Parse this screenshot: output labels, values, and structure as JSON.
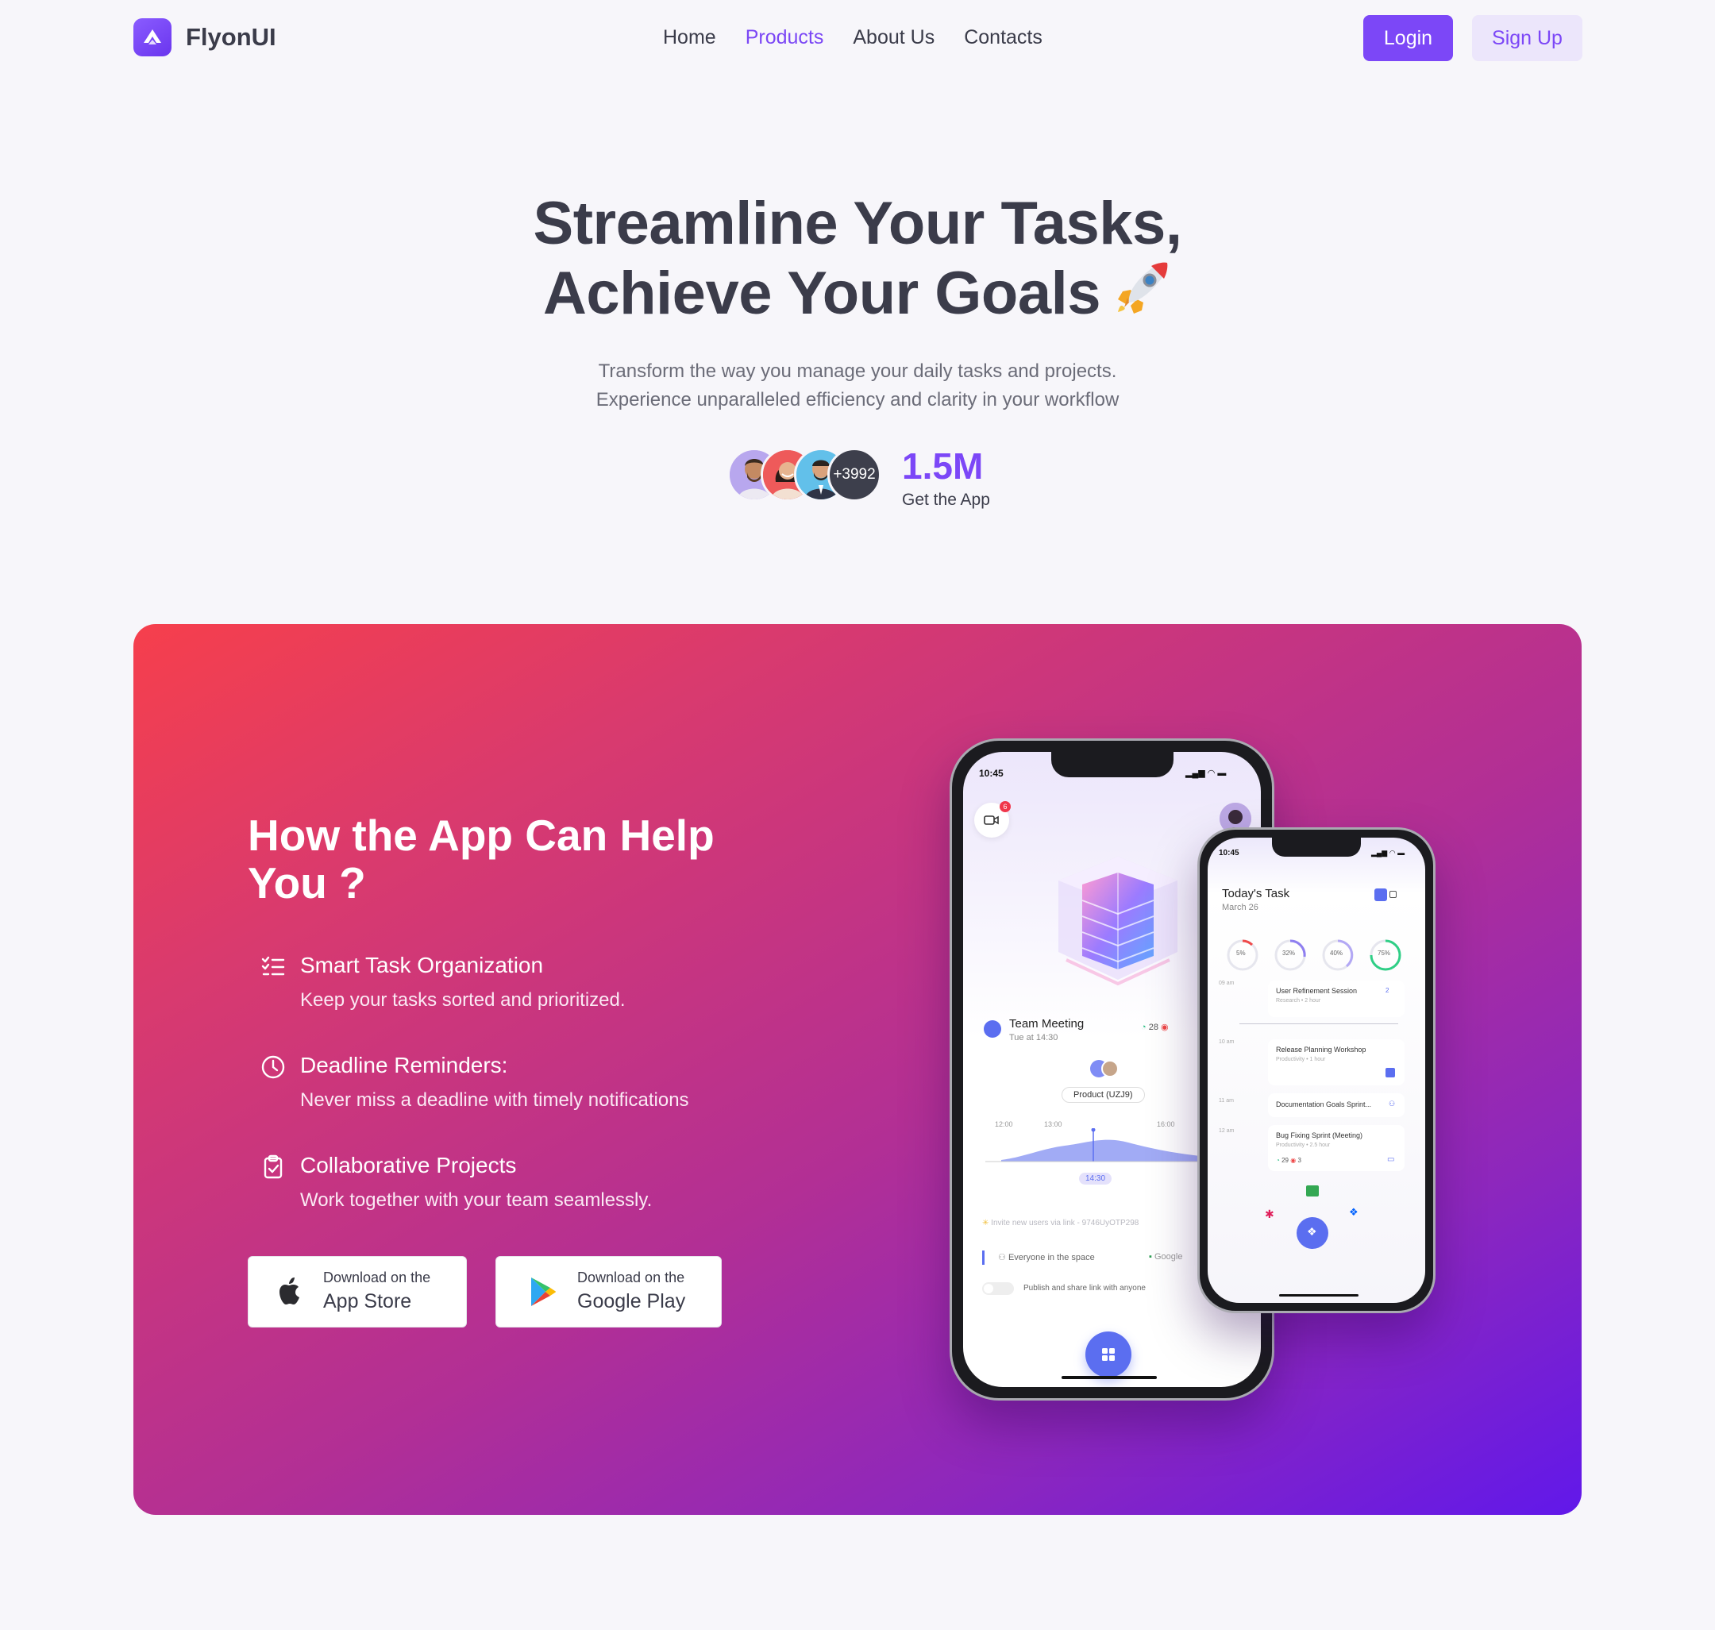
{
  "nav": {
    "brand": "FlyonUI",
    "links": [
      {
        "label": "Home",
        "active": false
      },
      {
        "label": "Products",
        "active": true
      },
      {
        "label": "About Us",
        "active": false
      },
      {
        "label": "Contacts",
        "active": false
      }
    ],
    "login_label": "Login",
    "signup_label": "Sign Up"
  },
  "hero": {
    "title_line1": "Streamline Your Tasks,",
    "title_line2": "Achieve Your Goals",
    "subtitle_line1": "Transform the way you manage your daily tasks and projects.",
    "subtitle_line2": "Experience unparalleled efficiency and clarity in your workflow",
    "avatar_more": "+3992",
    "stat_value": "1.5M",
    "stat_label": "Get the App"
  },
  "feature_card": {
    "title": "How the App Can Help You ?",
    "features": [
      {
        "icon": "checklist-icon",
        "title": "Smart Task Organization",
        "desc": "Keep your tasks sorted and prioritized."
      },
      {
        "icon": "clock-icon",
        "title": "Deadline Reminders:",
        "desc": "Never miss a deadline with timely notifications"
      },
      {
        "icon": "clipboard-check-icon",
        "title": "Collaborative Projects",
        "desc": "Work together with your team seamlessly."
      }
    ],
    "app_store": {
      "line1": "Download on the",
      "line2": "App Store"
    },
    "google_play": {
      "line1": "Download on the",
      "line2": "Google Play"
    }
  },
  "phone_large": {
    "time": "10:45",
    "badge": "6",
    "meeting_title": "Team Meeting",
    "meeting_time": "Tue at 14:30",
    "meeting_count": "28",
    "product_label": "Product (UZJ9)",
    "chart_ticks": [
      "12:00",
      "13:00",
      "16:00"
    ],
    "chart_marker": "14:30",
    "invite_text": "Invite new users via link - 9746UyOTP298",
    "space_text": "Everyone in the space",
    "google_text": "Google",
    "publish_text": "Publish and share link with anyone"
  },
  "phone_small": {
    "time": "10:45",
    "title": "Today's Task",
    "date": "March 26",
    "progress": [
      "5%",
      "32%",
      "40%",
      "75%"
    ],
    "hours": [
      "09 am",
      "10 am",
      "11 am",
      "12 am"
    ],
    "tasks": [
      {
        "title": "User Refinement Session",
        "meta": "Research  •  2 hour",
        "count": "2"
      },
      {
        "title": "Release Planning Workshop",
        "meta": "Productivity  •  1 hour"
      },
      {
        "title": "Documentation Goals Sprint...",
        "meta": ""
      },
      {
        "title": "Bug Fixing Sprint (Meeting)",
        "meta": "Productivity  •  2.5 hour",
        "count_a": "29",
        "count_b": "3"
      }
    ]
  },
  "colors": {
    "primary": "#7c47f7",
    "text": "#3b3c4a",
    "background": "#f7f6fa",
    "card_gradient_start": "#f63f4c",
    "card_gradient_end": "#6118ea"
  }
}
